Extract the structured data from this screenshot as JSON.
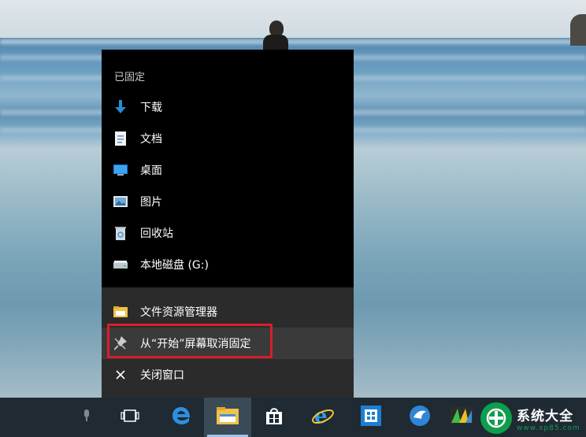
{
  "jumplist": {
    "pinned_label": "已固定",
    "pinned_items": [
      {
        "label": "下载",
        "icon": "download-arrow-icon"
      },
      {
        "label": "文档",
        "icon": "document-icon"
      },
      {
        "label": "桌面",
        "icon": "desktop-icon"
      },
      {
        "label": "图片",
        "icon": "pictures-icon"
      },
      {
        "label": "回收站",
        "icon": "recycle-bin-icon"
      },
      {
        "label": "本地磁盘 (G:)",
        "icon": "drive-icon"
      }
    ],
    "task_items": [
      {
        "label": "文件资源管理器",
        "icon": "file-explorer-icon"
      },
      {
        "label": "从“开始”屏幕取消固定",
        "icon": "unpin-icon"
      },
      {
        "label": "关闭窗口",
        "icon": "close-icon"
      }
    ]
  },
  "taskbar": {
    "items": [
      {
        "icon": "microphone-icon"
      },
      {
        "icon": "task-view-icon"
      },
      {
        "icon": "edge-icon"
      },
      {
        "icon": "file-explorer-icon",
        "active": true
      },
      {
        "icon": "store-icon"
      },
      {
        "icon": "internet-explorer-icon"
      },
      {
        "icon": "app-grid-icon"
      },
      {
        "icon": "bird-app-icon"
      },
      {
        "icon": "color-app-icon"
      }
    ]
  },
  "watermark": {
    "title": "系统大全",
    "url": "www.xp85.com"
  },
  "colors": {
    "menu_bg": "#000000",
    "tasks_bg": "#2b2b2b",
    "highlight": "#d81e2a",
    "taskbar_bg": "#1f2a33",
    "accent": "#2a8ad4"
  }
}
